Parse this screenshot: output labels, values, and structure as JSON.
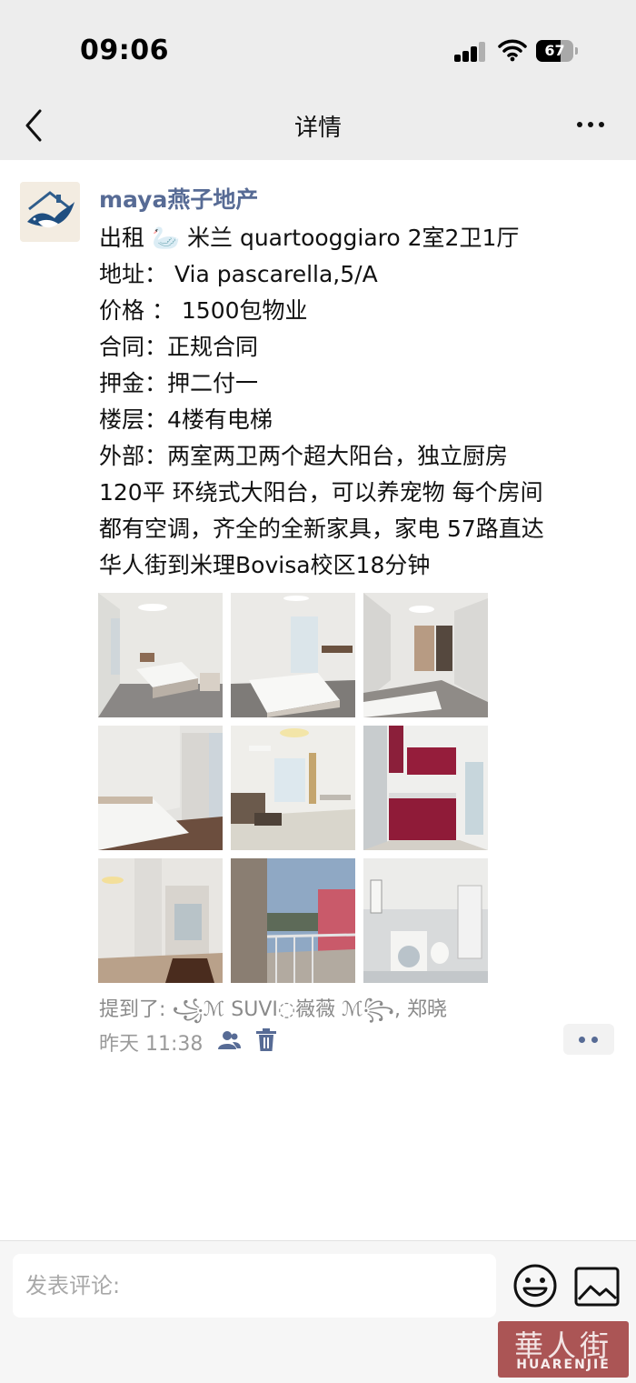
{
  "status_bar": {
    "time": "09:06",
    "battery": "67",
    "battery_level": 0.67
  },
  "nav": {
    "title": "详情",
    "back_icon": "chevron-left-icon",
    "more_icon": "more-dots-icon"
  },
  "post": {
    "author": "maya燕子地产",
    "lines": [
      "出租 🦢 米兰 quartooggiaro 2室2卫1厅",
      "地址： Via pascarella,5/A",
      "价格 ： 1500包物业",
      "合同：正规合同",
      "押金：押二付一",
      "楼层：4楼有电梯",
      "外部：两室两卫两个超大阳台，独立厨房",
      "120平 环绕式大阳台，可以养宠物 每个房间",
      "都有空调，齐全的全新家具，家电 57路直达",
      "华人街到米理Bovisa校区18分钟"
    ],
    "photos": [
      "bedroom-photo",
      "bedroom-photo",
      "bedroom-photo",
      "bedroom-photo",
      "living-room-photo",
      "kitchen-photo",
      "hallway-photo",
      "balcony-photo",
      "bathroom-photo"
    ],
    "mentions": "提到了: ꧁ℳ SUVI◌嶶薇 ℳ꧂, 郑晓",
    "time": "昨天 11:38"
  },
  "comment_bar": {
    "placeholder": "发表评论:"
  },
  "watermark": {
    "cn": "華人街",
    "en": "HUARENJIE"
  }
}
